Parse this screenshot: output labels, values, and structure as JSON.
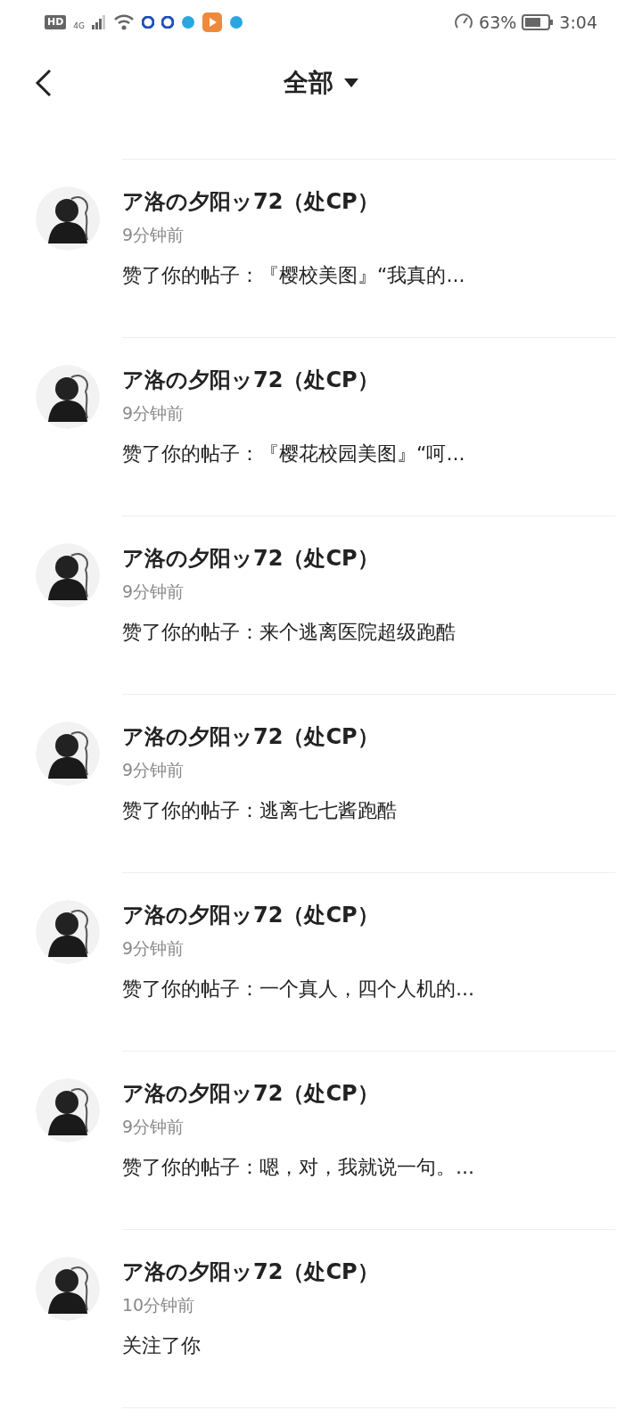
{
  "status_bar": {
    "hd": "HD",
    "network": "4G",
    "battery": "63%",
    "time": "3:04"
  },
  "header": {
    "title": "全部"
  },
  "notifications": [
    {
      "name": "ア洛の夕阳ッ72（处CP）",
      "time": "9分钟前",
      "text": "赞了你的帖子：『樱校美图』“我真的..."
    },
    {
      "name": "ア洛の夕阳ッ72（处CP）",
      "time": "9分钟前",
      "text": "赞了你的帖子：『樱花校园美图』“呵..."
    },
    {
      "name": "ア洛の夕阳ッ72（处CP）",
      "time": "9分钟前",
      "text": "赞了你的帖子：来个逃离医院超级跑酷"
    },
    {
      "name": "ア洛の夕阳ッ72（处CP）",
      "time": "9分钟前",
      "text": "赞了你的帖子：逃离七七酱跑酷"
    },
    {
      "name": "ア洛の夕阳ッ72（处CP）",
      "time": "9分钟前",
      "text": "赞了你的帖子：一个真人，四个人机的..."
    },
    {
      "name": "ア洛の夕阳ッ72（处CP）",
      "time": "9分钟前",
      "text": "赞了你的帖子：嗯，对，我就说一句。..."
    },
    {
      "name": "ア洛の夕阳ッ72（处CP）",
      "time": "10分钟前",
      "text": "关注了你"
    }
  ]
}
